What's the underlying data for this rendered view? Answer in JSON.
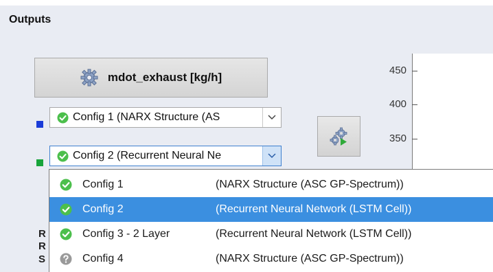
{
  "panel": {
    "title": "Outputs"
  },
  "output_button": {
    "label": "mdot_exhaust [kg/h]"
  },
  "combo1": {
    "value": "Config 1 (NARX Structure (AS",
    "color": "#1a3cd8"
  },
  "combo2": {
    "value": "Config 2 (Recurrent Neural Ne",
    "color": "#18a43b"
  },
  "axis": {
    "ticks": [
      "450",
      "400",
      "350"
    ]
  },
  "dropdown": {
    "options": [
      {
        "name": "Config 1",
        "desc": "(NARX Structure (ASC GP-Spectrum))",
        "status": "valid",
        "selected": false
      },
      {
        "name": "Config 2",
        "desc": "(Recurrent Neural Network (LSTM Cell))",
        "status": "valid",
        "selected": true
      },
      {
        "name": "Config 3 - 2 Layer",
        "desc": "(Recurrent Neural Network (LSTM Cell))",
        "status": "valid",
        "selected": false
      },
      {
        "name": "Config 4",
        "desc": "(NARX Structure (ASC GP-Spectrum))",
        "status": "unknown",
        "selected": false
      }
    ]
  },
  "background_letters": [
    "R",
    "R",
    "S"
  ],
  "colors": {
    "accent": "#3b8fe0",
    "check_green": "#4cbf4c",
    "unknown_gray": "#9a9a9a"
  }
}
